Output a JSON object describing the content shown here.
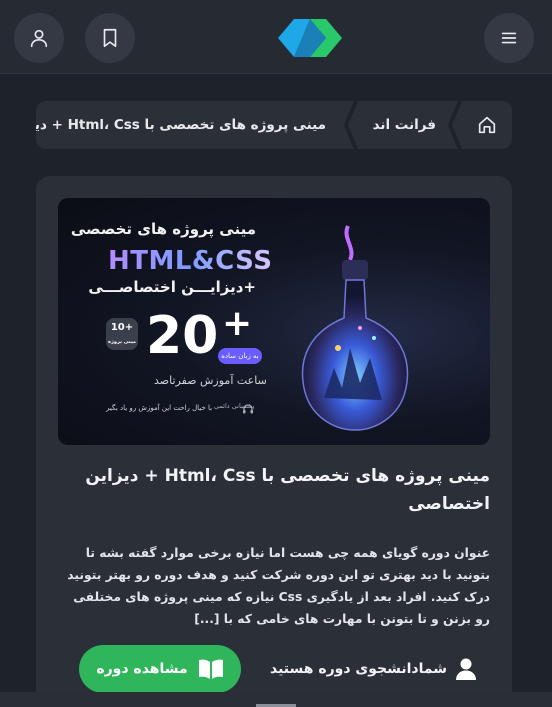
{
  "header": {
    "user_icon": "user-icon",
    "bookmark_icon": "bookmark-icon",
    "menu_icon": "menu-icon",
    "logo_colors": [
      "#1fa8e8",
      "#29c96b"
    ]
  },
  "breadcrumb": {
    "home_icon": "home-icon",
    "items": [
      "فرانت اند",
      "مینی پروژه های تخصصی با Html، Css + دیزاین اختصاصی"
    ]
  },
  "banner": {
    "title": "مینی پروژه های تخصصی",
    "tech": "HTML&CSS",
    "subtitle": "+دیزایـــن اختصاصـــی",
    "badge": "10+",
    "badge_sub": "مینی پروژه",
    "hours_number": "20",
    "plus": "+",
    "pill": "به زبان ساده",
    "hours_label": "ساعت آموزش صفرتاصد",
    "footer_note": "با خیال راحت این آموزش رو یاد بگیر",
    "support": "پشتیبانی دائمی"
  },
  "course": {
    "title": "مینی پروژه های تخصصی با Html، Css + دیزاین اختصاصی",
    "description": "عنوان دوره گویای همه چی هست اما نیازه برخی موارد گفته بشه تا بتونید با دید بهتری تو این دوره شرکت کنید و هدف دوره رو بهتر بتونید درک کنید. افراد بعد از یادگیری Css نیازه که مینی پروژه های مختلفی رو بزنن و تا بتونن با مهارت های خامی که با [...]",
    "view_button": "مشاهده دوره",
    "student_status": "شمادانشجوی دوره هستید"
  },
  "colors": {
    "accent_green": "#2fb65a",
    "background": "#1e222a",
    "card": "#2b2f38"
  }
}
